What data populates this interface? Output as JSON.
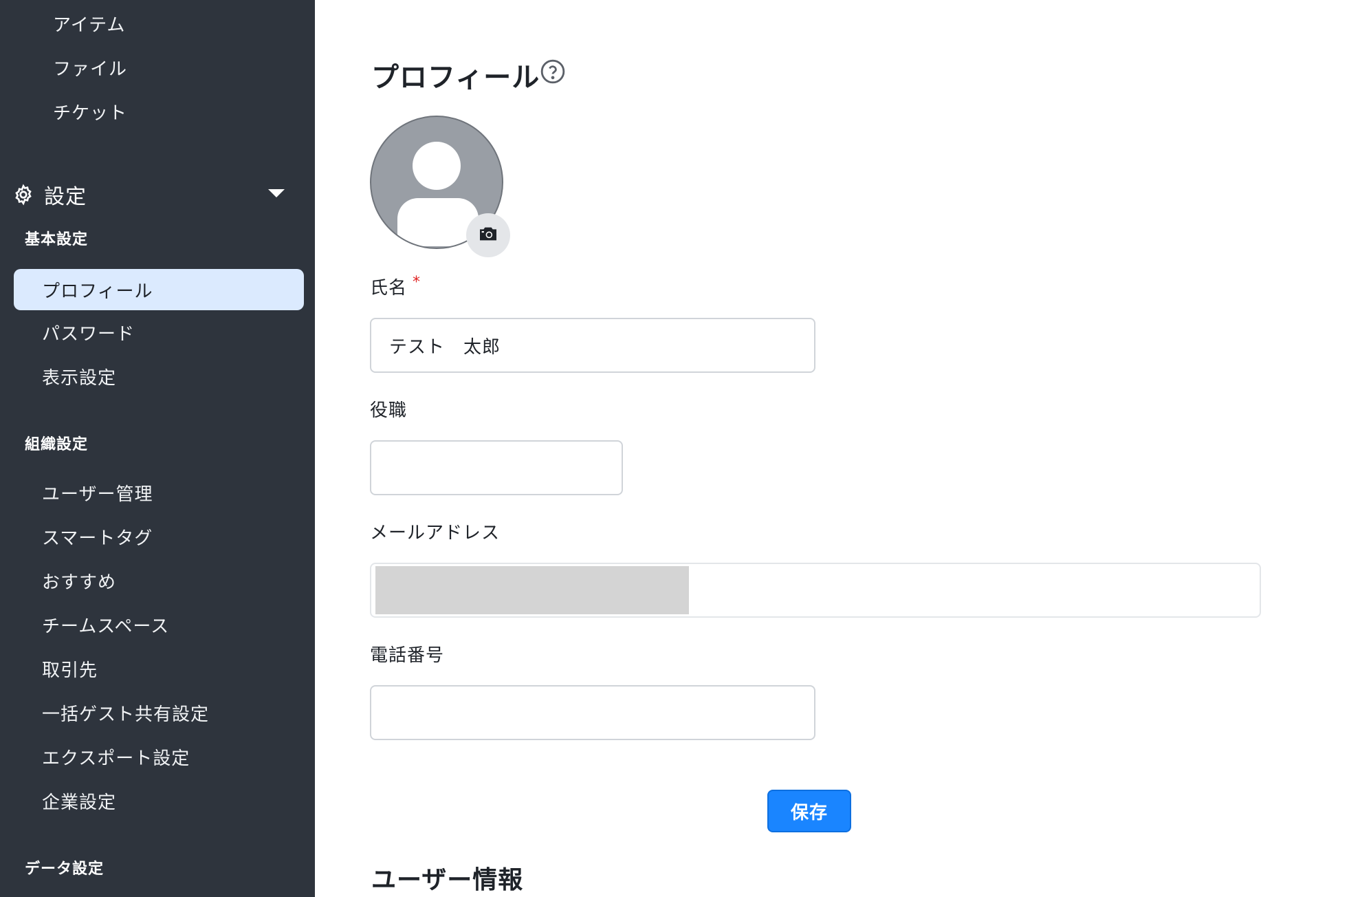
{
  "sidebar": {
    "top_items": [
      "アイテム",
      "ファイル",
      "チケット"
    ],
    "settings_label": "設定",
    "groups": {
      "basic": {
        "label": "基本設定",
        "items": [
          "プロフィール",
          "パスワード",
          "表示設定"
        ]
      },
      "org": {
        "label": "組織設定",
        "items": [
          "ユーザー管理",
          "スマートタグ",
          "おすすめ",
          "チームスペース",
          "取引先",
          "一括ゲスト共有設定",
          "エクスポート設定",
          "企業設定"
        ]
      },
      "data": {
        "label": "データ設定"
      }
    },
    "active_item": "プロフィール",
    "icons": {
      "settings": "gear-icon",
      "expand": "caret-down-icon"
    }
  },
  "main": {
    "title": "プロフィール",
    "help_icon": "question-circle-icon",
    "avatar_icon": "user-avatar-placeholder",
    "camera_icon": "camera-icon",
    "fields": {
      "name": {
        "label": "氏名",
        "required_mark": "*",
        "value": "テスト　太郎"
      },
      "position": {
        "label": "役職",
        "value": ""
      },
      "email": {
        "label": "メールアドレス",
        "value": ""
      },
      "phone": {
        "label": "電話番号",
        "value": ""
      }
    },
    "save_label": "保存",
    "user_info_title": "ユーザー情報"
  },
  "colors": {
    "sidebar_bg": "#2e343d",
    "active_item_bg": "#dbeafe",
    "primary_button": "#1a85ff",
    "required": "#e02424"
  }
}
